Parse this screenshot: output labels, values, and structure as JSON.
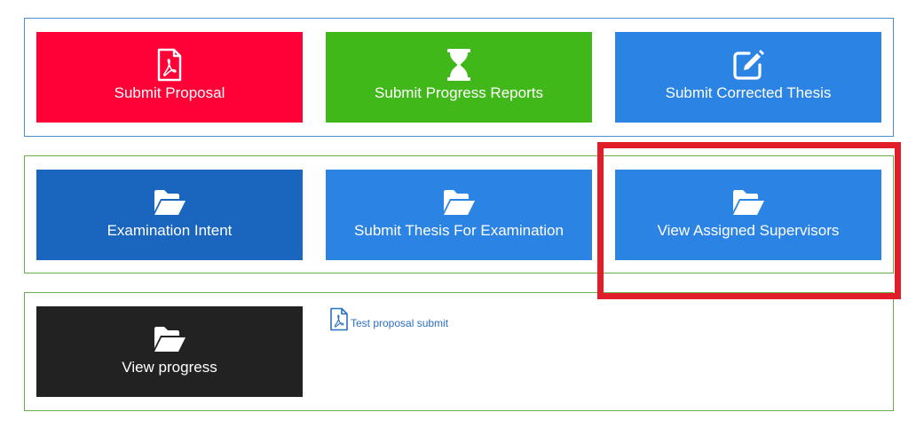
{
  "colors": {
    "tile_red": "#ff0037",
    "tile_green": "#41b819",
    "tile_blue": "#2b83e3",
    "tile_darkblue": "#1a66bf",
    "tile_black": "#222222",
    "highlight_box": "#e11d2a",
    "link": "#2b6fc2"
  },
  "row1": {
    "submit_proposal": {
      "label": "Submit Proposal",
      "icon": "pdf-file-icon"
    },
    "submit_progress_reports": {
      "label": "Submit Progress Reports",
      "icon": "hourglass-icon"
    },
    "submit_corrected_thesis": {
      "label": "Submit Corrected Thesis",
      "icon": "edit-icon"
    }
  },
  "row2": {
    "examination_intent": {
      "label": "Examination Intent",
      "icon": "folder-open-icon"
    },
    "submit_thesis": {
      "label": "Submit Thesis For Examination",
      "icon": "folder-open-icon"
    },
    "view_assigned_supervisors": {
      "label": "View Assigned Supervisors",
      "icon": "folder-open-icon"
    }
  },
  "row3": {
    "view_progress": {
      "label": "View progress",
      "icon": "folder-open-icon"
    },
    "test_proposal_link": {
      "label": "Test proposal submit",
      "icon": "pdf-file-icon"
    }
  }
}
